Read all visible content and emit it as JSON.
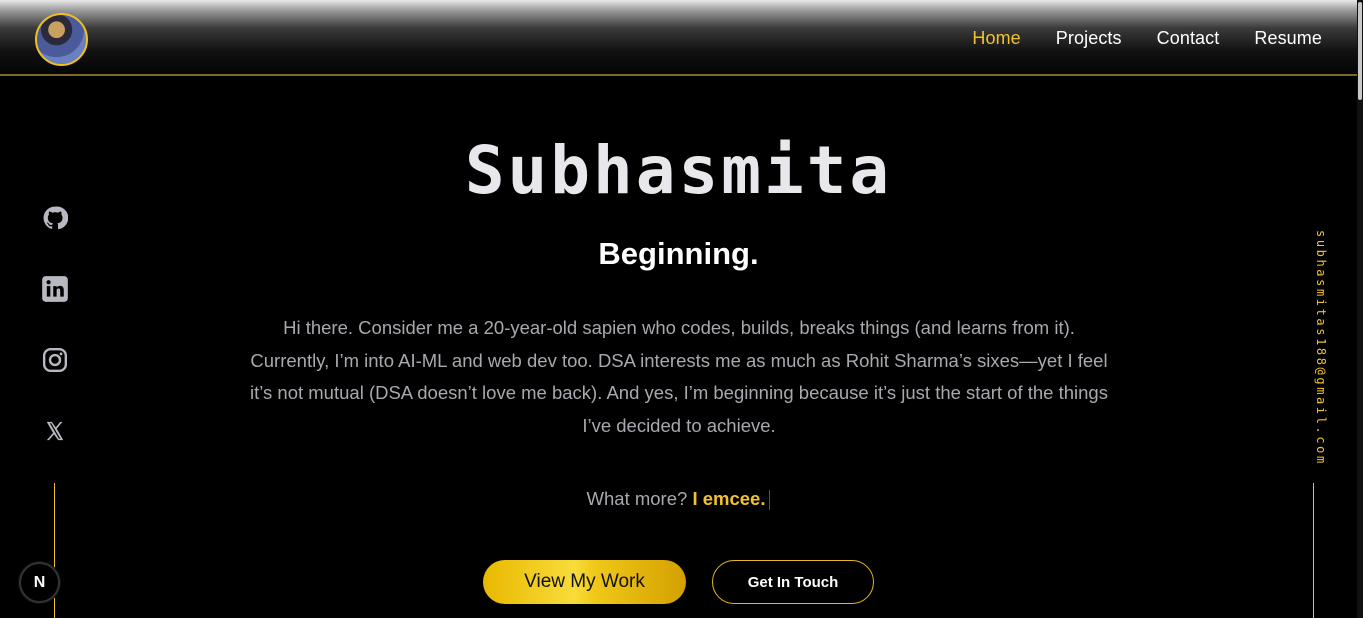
{
  "nav": {
    "links": [
      {
        "label": "Home",
        "active": true
      },
      {
        "label": "Projects",
        "active": false
      },
      {
        "label": "Contact",
        "active": false
      },
      {
        "label": "Resume",
        "active": false
      }
    ]
  },
  "socials": [
    "github-icon",
    "linkedin-icon",
    "instagram-icon",
    "x-icon"
  ],
  "email": "subhasmitas188@gmail.com",
  "hero": {
    "name": "Subhasmita",
    "tagline": "Beginning.",
    "bio": "Hi there. Consider me a 20-year-old sapien who codes, builds, breaks things (and learns from it). Currently, I’m into AI-ML and web dev too. DSA interests me as much as Rohit Sharma’s sixes—yet I feel it’s not mutual (DSA doesn’t love me back). And yes, I’m beginning because it’s just the start of the things I’ve decided to achieve.",
    "more_prefix": "What more?",
    "more_highlight": "I emcee."
  },
  "buttons": {
    "primary": "View My Work",
    "secondary": "Get In Touch"
  },
  "badge": "N",
  "colors": {
    "accent": "#f2c12e",
    "background": "#000000",
    "text_muted": "#a8a8ae"
  }
}
